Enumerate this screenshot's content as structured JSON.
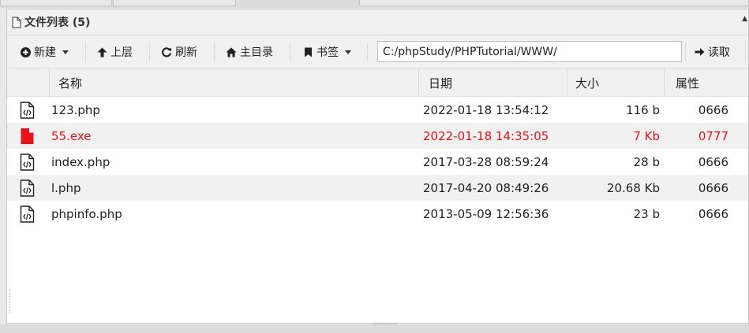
{
  "panel": {
    "title": "文件列表 (5)"
  },
  "toolbar": {
    "new_label": "新建",
    "up_label": "上层",
    "refresh_label": "刷新",
    "home_label": "主目录",
    "bookmark_label": "书签",
    "path_value": "C:/phpStudy/PHPTutorial/WWW/",
    "read_label": "读取"
  },
  "columns": {
    "name": "名称",
    "date": "日期",
    "size": "大小",
    "attr": "属性"
  },
  "files": [
    {
      "name": "123.php",
      "date": "2022-01-18 13:54:12",
      "size": "116 b",
      "attr": "0666",
      "icon": "php-file-icon"
    },
    {
      "name": "55.exe",
      "date": "2022-01-18 14:35:05",
      "size": "7 Kb",
      "attr": "0777",
      "icon": "exe-file-icon",
      "highlight": "#e8121b"
    },
    {
      "name": "index.php",
      "date": "2017-03-28 08:59:24",
      "size": "28 b",
      "attr": "0666",
      "icon": "php-file-icon"
    },
    {
      "name": "l.php",
      "date": "2017-04-20 08:49:26",
      "size": "20.68 Kb",
      "attr": "0666",
      "icon": "php-file-icon"
    },
    {
      "name": "phpinfo.php",
      "date": "2013-05-09 12:56:36",
      "size": "23 b",
      "attr": "0666",
      "icon": "php-file-icon"
    }
  ]
}
